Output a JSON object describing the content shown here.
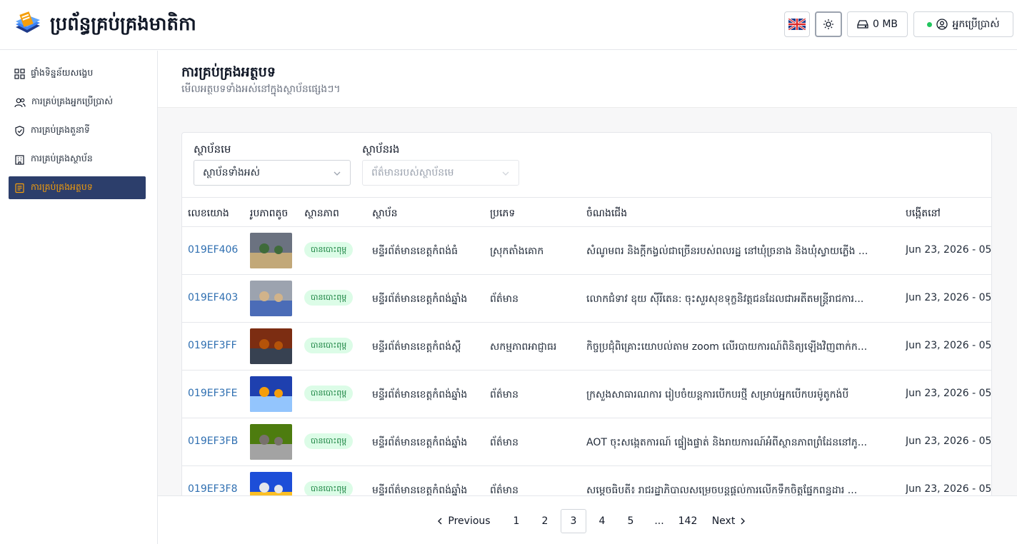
{
  "header": {
    "app_title": "ប្រព័ន្ធគ្រប់គ្រងមាតិកា",
    "storage": "0 MB",
    "user_label": "អ្នកប្រើប្រាស់"
  },
  "sidebar": {
    "items": [
      {
        "label": "ផ្ទាំងទិន្នន័យសង្ខេប",
        "icon": "dashboard-icon"
      },
      {
        "label": "ការគ្រប់គ្រងអ្នកប្រើប្រាស់",
        "icon": "users-icon"
      },
      {
        "label": "ការគ្រប់គ្រងតួនាទី",
        "icon": "shield-icon"
      },
      {
        "label": "ការគ្រប់គ្រងស្ថាប័ន",
        "icon": "building-icon"
      },
      {
        "label": "ការគ្រប់គ្រងអត្ថបទ",
        "icon": "article-icon",
        "active": true
      }
    ]
  },
  "page": {
    "title": "ការគ្រប់គ្រងអត្ថបទ",
    "subtitle": "មើលអត្ថបទទាំងអស់នៅក្នុងស្ថាប័នផ្សេងៗ។"
  },
  "filters": {
    "parent_label": "ស្ថាប័នមេ",
    "parent_value": "ស្ថាប័នទាំងអស់",
    "child_label": "ស្ថាប័នរង",
    "child_placeholder": "ព័ត៌មានរបស់ស្ថាប័នមេ"
  },
  "table": {
    "columns": [
      "លេខយោង",
      "រូបភាពតូច",
      "ស្ថានភាព",
      "ស្ថាប័ន",
      "ប្រភេទ",
      "ចំណងជើង",
      "បង្កើតនៅ"
    ],
    "rows": [
      {
        "ref": "019EF406",
        "status": "បានបោះពុម្ព",
        "org": "មន្ទីរព័ត៌មានខេត្តកំពង់ធំ",
        "category": "ស្រុកតាំងគោក",
        "title": "សំណូមពរ និងក្តីកង្វល់ជាច្រើនរបស់ពលរដ្ឋ នៅឃុំច្រនាង និងឃុំស្វាយភ្លើង ...",
        "created": "Jun 23, 2026 - 05:"
      },
      {
        "ref": "019EF403",
        "status": "បានបោះពុម្ព",
        "org": "មន្ទីរព័ត៌មានខេត្តកំពង់ឆ្នាំង",
        "category": "ព័ត៌មាន",
        "title": "លោកជំទាវ ឧុយ ស៊ីរីតេន: ចុះសួរសុខទុក្ខនិវត្តជនដែលជាអតីតមន្ត្រីរាជការ...",
        "created": "Jun 23, 2026 - 05:"
      },
      {
        "ref": "019EF3FF",
        "status": "បានបោះពុម្ព",
        "org": "មន្ទីរព័ត៌មានខេត្តកំពង់ស្ពឺ",
        "category": "សកម្មភាពអាជ្ញាធរ",
        "title": "កិច្ចប្រជុំពិគ្រោះយោបល់តាម zoom លើរបាយការណ៍ពិនិត្យឡើងវិញពាក់ក...",
        "created": "Jun 23, 2026 - 05:"
      },
      {
        "ref": "019EF3FE",
        "status": "បានបោះពុម្ព",
        "org": "មន្ទីរព័ត៌មានខេត្តកំពង់ឆ្នាំង",
        "category": "ព័ត៌មាន",
        "title": "ក្រសួងសាធារណការ រៀបចំយន្តការបើកបរថ្មី សម្រាប់អ្នកបើកបរម៉ូតូកង់បី",
        "created": "Jun 23, 2026 - 05:"
      },
      {
        "ref": "019EF3FB",
        "status": "បានបោះពុម្ព",
        "org": "មន្ទីរព័ត៌មានខេត្តកំពង់ឆ្នាំង",
        "category": "ព័ត៌មាន",
        "title": "AOT ចុះសង្កេតការណ៍ ផ្ទៀងផ្ទាត់ និងរាយការណ៍អំពីស្ថានភាពព្រំដែននៅភូ...",
        "created": "Jun 23, 2026 - 05:"
      },
      {
        "ref": "019EF3F8",
        "status": "បានបោះពុម្ព",
        "org": "មន្ទីរព័ត៌មានខេត្តកំពង់ឆ្នាំង",
        "category": "ព័ត៌មាន",
        "title": "សម្តេចធិបតី៖ រាជរដ្ឋាភិបាលសម្រេចបន្តផ្តល់ការលើកទឹកចិត្តផ្នែកពន្ធដារ ...",
        "created": "Jun 23, 2026 - 05:"
      }
    ]
  },
  "pagination": {
    "previous": "Previous",
    "next": "Next",
    "pages": [
      "1",
      "2",
      "3",
      "4",
      "5",
      "...",
      "142"
    ],
    "current": "3"
  },
  "colors": {
    "accent": "#2c3e6b",
    "active_text": "#f59e0b",
    "link": "#2f6fb1",
    "badge_bg": "#dcfce7",
    "badge_text": "#15803d"
  }
}
